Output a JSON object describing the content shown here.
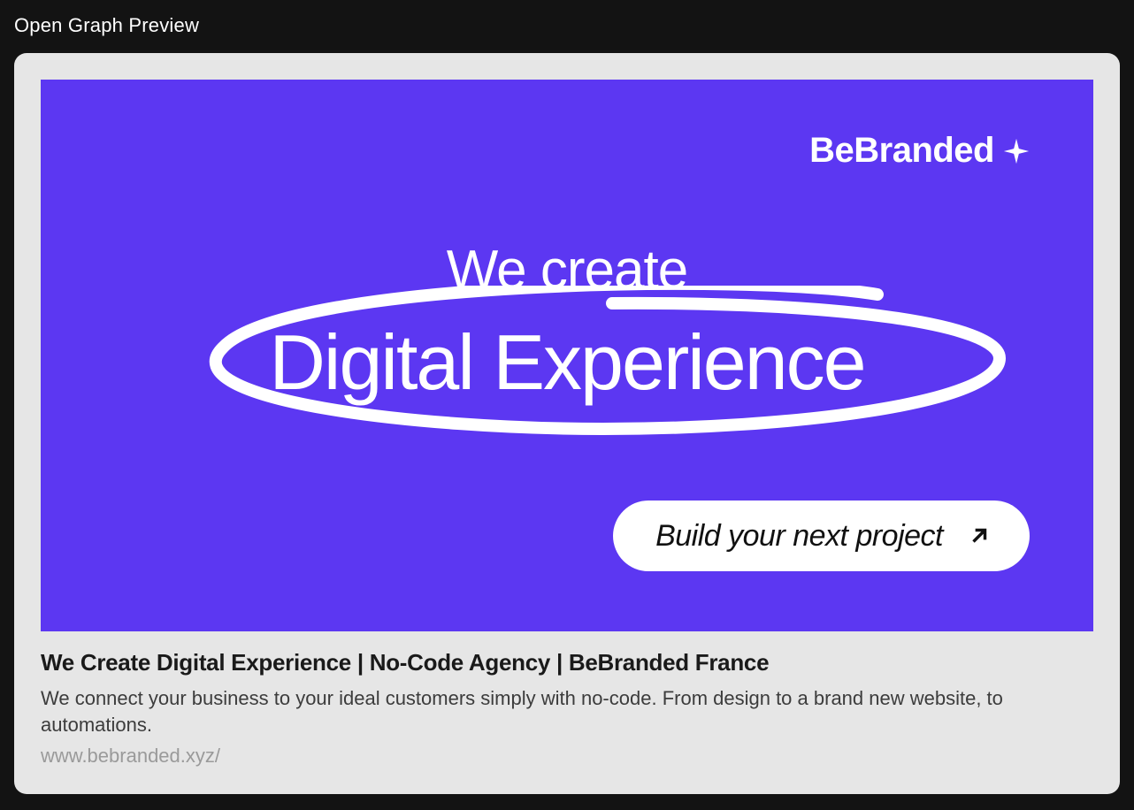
{
  "page": {
    "title": "Open Graph Preview"
  },
  "preview": {
    "image": {
      "bg_color": "#5c37f2",
      "brand": "BeBranded",
      "headline_line1": "We create",
      "headline_line2": "Digital Experience",
      "cta_label": "Build your next project"
    },
    "title": "We Create Digital Experience | No-Code Agency | BeBranded France",
    "description": "We connect your business to your ideal customers simply with no-code. From design to a brand new website, to automations.",
    "url": "www.bebranded.xyz/"
  }
}
